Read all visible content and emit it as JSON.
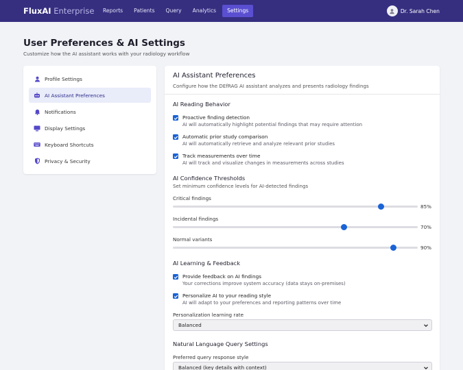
{
  "brand": {
    "bold": "FluxAI",
    "light": "Enterprise"
  },
  "nav": [
    "Reports",
    "Patients",
    "Query",
    "Analytics",
    "Settings"
  ],
  "user": {
    "name": "Dr. Sarah Chen"
  },
  "page": {
    "title": "User Preferences & AI Settings",
    "subtitle": "Customize how the AI assistant works with your radiology workflow"
  },
  "sidebar": {
    "items": [
      {
        "label": "Profile Settings",
        "icon": "user-icon"
      },
      {
        "label": "AI Assistant Preferences",
        "icon": "robot-icon"
      },
      {
        "label": "Notifications",
        "icon": "bell-icon"
      },
      {
        "label": "Display Settings",
        "icon": "monitor-icon"
      },
      {
        "label": "Keyboard Shortcuts",
        "icon": "keyboard-icon"
      },
      {
        "label": "Privacy & Security",
        "icon": "shield-icon"
      }
    ]
  },
  "panel": {
    "title": "AI Assistant Preferences",
    "subtitle": "Configure how the DEfRAG AI assistant analyzes and presents radiology findings",
    "reading": {
      "heading": "AI Reading Behavior",
      "options": [
        {
          "label": "Proactive finding detection",
          "desc": "AI will automatically highlight potential findings that may require attention",
          "checked": true
        },
        {
          "label": "Automatic prior study comparison",
          "desc": "AI will automatically retrieve and analyze relevant prior studies",
          "checked": true
        },
        {
          "label": "Track measurements over time",
          "desc": "AI will track and visualize changes in measurements across studies",
          "checked": true
        }
      ]
    },
    "thresholds": {
      "heading": "AI Confidence Thresholds",
      "subtitle": "Set minimum confidence levels for AI-detected findings",
      "sliders": [
        {
          "label": "Critical findings",
          "value": 85,
          "display": "85%"
        },
        {
          "label": "Incidental findings",
          "value": 70,
          "display": "70%"
        },
        {
          "label": "Normal variants",
          "value": 90,
          "display": "90%"
        }
      ]
    },
    "learning": {
      "heading": "AI Learning & Feedback",
      "options": [
        {
          "label": "Provide feedback on AI findings",
          "desc": "Your corrections improve system accuracy (data stays on-premises)",
          "checked": true
        },
        {
          "label": "Personalize AI to your reading style",
          "desc": "AI will adapt to your preferences and reporting patterns over time",
          "checked": true
        }
      ],
      "rate_label": "Personalization learning rate",
      "rate_value": "Balanced"
    },
    "nlq": {
      "heading": "Natural Language Query Settings",
      "style_label": "Preferred query response style",
      "style_value": "Balanced (key details with context)"
    }
  },
  "colors": {
    "nav_bg": "#362f80",
    "nav_active": "#5a4fd0",
    "accent": "#1a63d6"
  }
}
